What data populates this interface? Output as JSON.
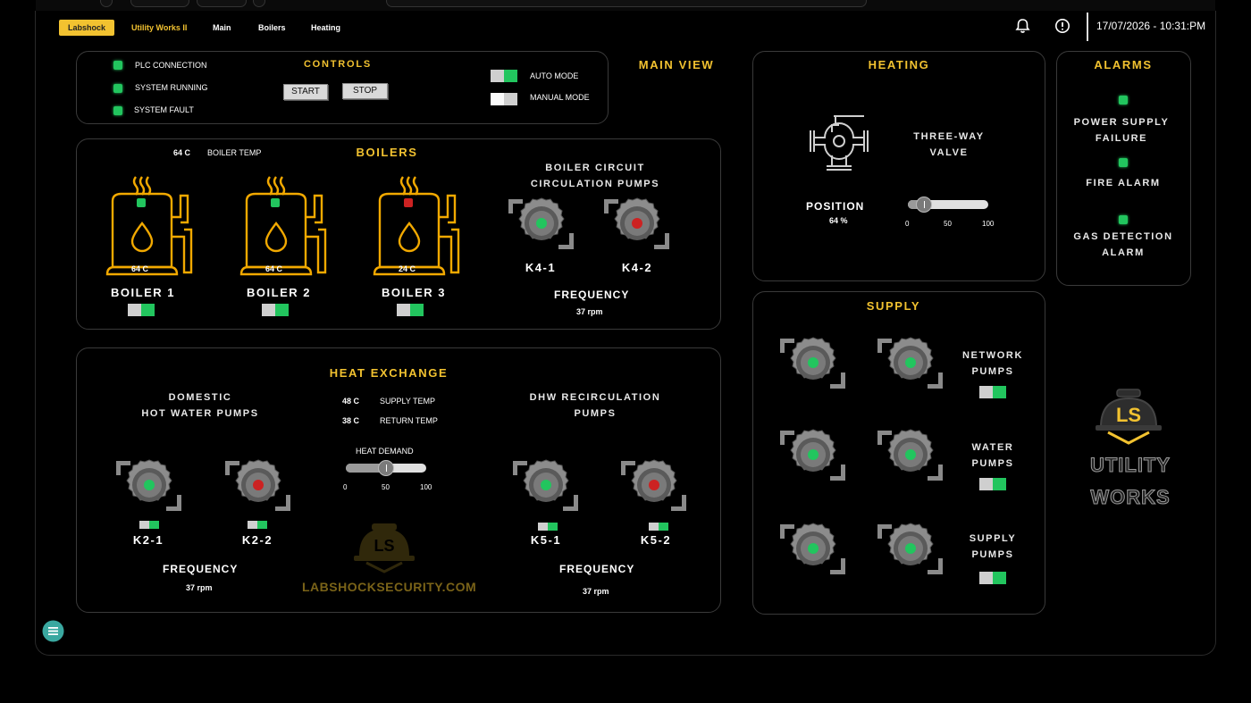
{
  "nav": {
    "tabs": [
      {
        "label": "Labshock"
      },
      {
        "label": "Utility Works II"
      },
      {
        "label": "Main"
      },
      {
        "label": "Boilers"
      },
      {
        "label": "Heating"
      }
    ],
    "datetime": "17/07/2026 - 10:31:PM",
    "bell_icon": "bell-icon",
    "alert_icon": "alert-circle-icon"
  },
  "colors": {
    "accent": "#f2c230",
    "ok": "#22c55e",
    "fault": "#cc2222",
    "panel_border": "#3a3a3a"
  },
  "controls": {
    "title": "CONTROLS",
    "status": [
      {
        "label": "PLC CONNECTION",
        "state": "ok"
      },
      {
        "label": "SYSTEM RUNNING",
        "state": "ok"
      },
      {
        "label": "SYSTEM FAULT",
        "state": "ok"
      }
    ],
    "start_label": "START",
    "stop_label": "STOP",
    "auto_mode": {
      "label": "AUTO MODE",
      "on": true
    },
    "manual_mode": {
      "label": "MANUAL MODE",
      "on": false
    }
  },
  "main_view": "MAIN VIEW",
  "boilers": {
    "title": "BOILERS",
    "boiler_temp_value": "64 C",
    "boiler_temp_label": "BOILER TEMP",
    "units": [
      {
        "name": "BOILER 1",
        "temp": "64 C",
        "status": "ok",
        "enabled": true
      },
      {
        "name": "BOILER 2",
        "temp": "64 C",
        "status": "ok",
        "enabled": true
      },
      {
        "name": "BOILER 3",
        "temp": "24 C",
        "status": "fault",
        "enabled": true
      }
    ],
    "circ_title_line1": "BOILER CIRCUIT",
    "circ_title_line2": "CIRCULATION PUMPS",
    "pumps": [
      {
        "name": "K4-1",
        "status": "ok"
      },
      {
        "name": "K4-2",
        "status": "fault"
      }
    ],
    "frequency_label": "FREQUENCY",
    "frequency_value": "37 rpm"
  },
  "heat_exchange": {
    "title": "HEAT EXCHANGE",
    "dhw_title_line1": "DOMESTIC",
    "dhw_title_line2": "HOT WATER PUMPS",
    "dhw_pumps": [
      {
        "name": "K2-1",
        "status": "ok",
        "enabled": true
      },
      {
        "name": "K2-2",
        "status": "fault",
        "enabled": true
      }
    ],
    "supply_temp_value": "48 C",
    "supply_temp_label": "SUPPLY TEMP",
    "return_temp_value": "38 C",
    "return_temp_label": "RETURN TEMP",
    "heat_demand": {
      "label": "HEAT DEMAND",
      "value": 50,
      "min": "0",
      "mid": "50",
      "max": "100"
    },
    "recirc_title_line1": "DHW RECIRCULATION",
    "recirc_title_line2": "PUMPS",
    "recirc_pumps": [
      {
        "name": "K5-1",
        "status": "ok",
        "enabled": true
      },
      {
        "name": "K5-2",
        "status": "fault",
        "enabled": true
      }
    ],
    "frequency_label": "FREQUENCY",
    "dhw_frequency_value": "37 rpm",
    "recirc_frequency_value": "37 rpm",
    "watermark_text": "LABSHOCKSECURITY.COM",
    "watermark_logo": "LS"
  },
  "heating": {
    "title": "HEATING",
    "valve_line1": "THREE-WAY",
    "valve_line2": "VALVE",
    "position_label": "POSITION",
    "position_value": "64 %",
    "position_pct": 64,
    "min": "0",
    "mid": "50",
    "max": "100"
  },
  "alarms": {
    "title": "ALARMS",
    "items": [
      {
        "line1": "POWER SUPPLY",
        "line2": "FAILURE",
        "state": "ok"
      },
      {
        "line1": "FIRE ALARM",
        "line2": "",
        "state": "ok"
      },
      {
        "line1": "GAS DETECTION",
        "line2": "ALARM",
        "state": "ok"
      }
    ]
  },
  "supply": {
    "title": "SUPPLY",
    "groups": [
      {
        "line1": "NETWORK",
        "line2": "PUMPS",
        "enabled": true
      },
      {
        "line1": "WATER",
        "line2": "PUMPS",
        "enabled": true
      },
      {
        "line1": "SUPPLY",
        "line2": "PUMPS",
        "enabled": true
      }
    ]
  },
  "brand": {
    "logo": "LS",
    "line1": "UTILITY",
    "line2": "WORKS"
  },
  "menu_icon": "menu-icon"
}
